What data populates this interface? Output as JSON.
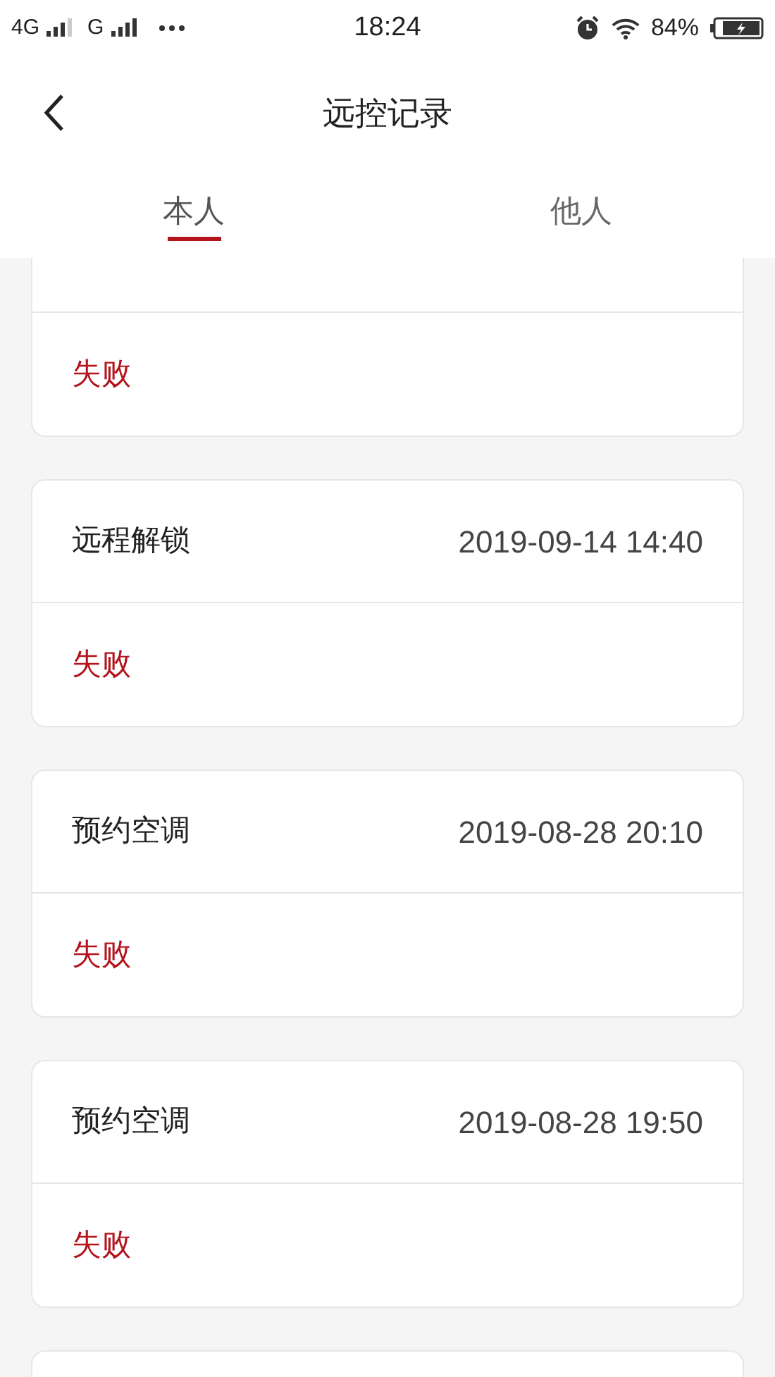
{
  "status_bar": {
    "network_1": "4G",
    "network_2": "G",
    "time": "18:24",
    "battery": "84%"
  },
  "header": {
    "title": "远控记录"
  },
  "tabs": [
    {
      "label": "本人",
      "selected": true
    },
    {
      "label": "他人",
      "selected": false
    }
  ],
  "records": [
    {
      "kind": "partial",
      "status": "失败"
    },
    {
      "kind": "full",
      "action": "远程解锁",
      "time": "2019-09-14 14:40",
      "status": "失败"
    },
    {
      "kind": "full",
      "action": "预约空调",
      "time": "2019-08-28 20:10",
      "status": "失败"
    },
    {
      "kind": "full",
      "action": "预约空调",
      "time": "2019-08-28 19:50",
      "status": "失败"
    },
    {
      "kind": "edge"
    }
  ]
}
